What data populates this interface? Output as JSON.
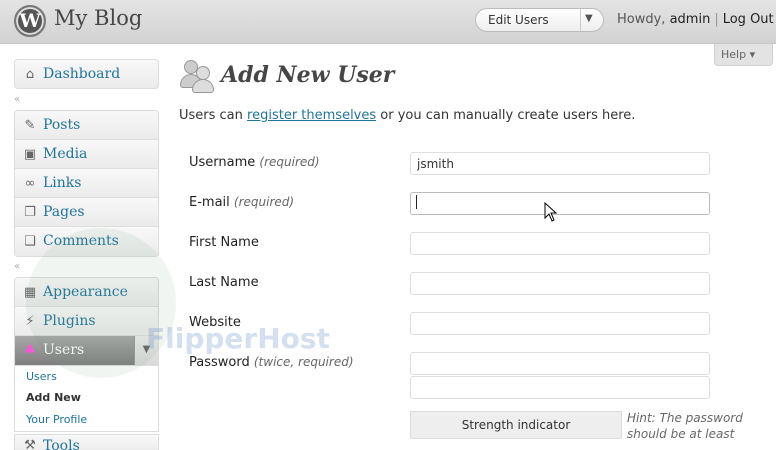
{
  "header": {
    "blog_title": "My Blog",
    "favorite_action": "Edit Users",
    "greeting": "Howdy,",
    "username": "admin",
    "separator": "|",
    "logout": "Log Out"
  },
  "help_tab": "Help ▾",
  "sidebar": {
    "dashboard": "Dashboard",
    "collapse_glyph": "«",
    "content_group": [
      {
        "label": "Posts",
        "icon": "pushpin-icon"
      },
      {
        "label": "Media",
        "icon": "media-icon"
      },
      {
        "label": "Links",
        "icon": "link-icon"
      },
      {
        "label": "Pages",
        "icon": "pages-icon"
      },
      {
        "label": "Comments",
        "icon": "comment-icon"
      }
    ],
    "appearance_group": [
      {
        "label": "Appearance",
        "icon": "appearance-icon"
      },
      {
        "label": "Plugins",
        "icon": "plugin-icon"
      },
      {
        "label": "Users",
        "icon": "users-icon"
      }
    ],
    "users_submenu": [
      "Users",
      "Add New",
      "Your Profile"
    ],
    "tools": "Tools"
  },
  "main": {
    "title": "Add New User",
    "intro_before": "Users can ",
    "intro_link": "register themselves",
    "intro_after": " or you can manually create users here.",
    "fields": {
      "username": {
        "label": "Username",
        "note": "(required)",
        "value": "jsmith"
      },
      "email": {
        "label": "E-mail",
        "note": "(required)",
        "value": ""
      },
      "first_name": {
        "label": "First Name",
        "value": ""
      },
      "last_name": {
        "label": "Last Name",
        "value": ""
      },
      "website": {
        "label": "Website",
        "value": ""
      },
      "password": {
        "label": "Password",
        "note": "(twice, required)",
        "value": "",
        "confirm": ""
      }
    },
    "strength_indicator": "Strength indicator",
    "hint": "Hint: The password should be at least"
  },
  "watermark": "FlipperHost"
}
